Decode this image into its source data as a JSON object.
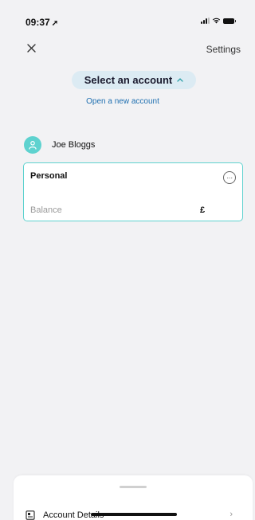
{
  "status_bar": {
    "time": "09:37",
    "location_icon": "location-arrow-icon",
    "signal_icon": "signal-icon",
    "wifi_icon": "wifi-icon",
    "battery_icon": "battery-icon"
  },
  "header": {
    "close_icon": "close-icon",
    "settings_label": "Settings"
  },
  "account_selector": {
    "label": "Select an account",
    "chevron_icon": "chevron-up-icon"
  },
  "open_account_link": "Open a new account",
  "user": {
    "name": "Joe Bloggs",
    "avatar_icon": "person-icon"
  },
  "account_card": {
    "title": "Personal",
    "more_icon": "more-icon",
    "balance_label": "Balance",
    "balance_value": "£"
  },
  "bottom_sheet": {
    "row_label": "Account Details",
    "row_icon": "document-icon",
    "chevron_icon": "chevron-right-icon"
  },
  "colors": {
    "accent": "#5ed2cf",
    "link": "#1e6fb0",
    "selector_bg": "#dcebf3",
    "background": "#f2f2f4"
  }
}
